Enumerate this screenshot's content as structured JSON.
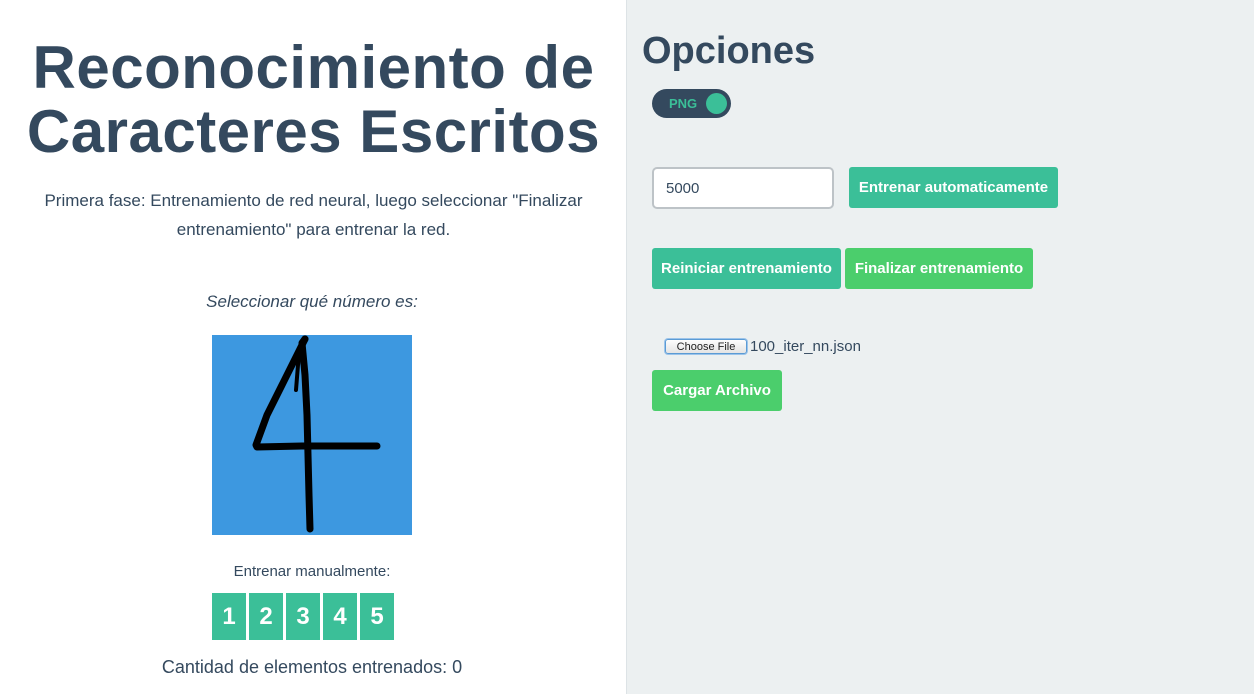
{
  "left_panel": {
    "title": "Reconocimiento de Caracteres Escritos",
    "intro": "Primera fase: Entrenamiento de red neural, luego seleccionar \"Finalizar entrenamiento\" para entrenar la red.",
    "select_label": "Seleccionar qué número es:",
    "manual_label": "Entrenar manualmente:",
    "digits": [
      "1",
      "2",
      "3",
      "4",
      "5"
    ],
    "count_text": "Cantidad de elementos entrenados: 0",
    "canvas_color": "#3d98e0"
  },
  "right_panel": {
    "title": "Opciones",
    "toggle_label": "PNG",
    "iterations_value": "5000",
    "auto_train_label": "Entrenar automaticamente",
    "reset_label": "Reiniciar entrenamiento",
    "finish_label": "Finalizar entrenamiento",
    "choose_file_label": "Choose File",
    "file_name": "100_iter_nn.json",
    "load_label": "Cargar Archivo"
  },
  "colors": {
    "teal": "#3bbf98",
    "green": "#4bce6c",
    "navy": "#34495e",
    "background": "#ecf0f1"
  }
}
